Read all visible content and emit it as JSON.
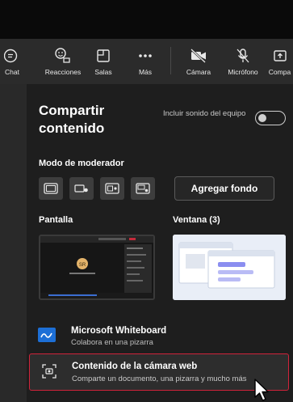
{
  "toolbar": {
    "chat": "Chat",
    "reactions": "Reacciones",
    "rooms": "Salas",
    "more": "Más",
    "camera": "Cámara",
    "mic": "Micrófono",
    "share": "Compa"
  },
  "panel": {
    "title": "Compartir contenido",
    "include_sound": "Incluir sonido del equipo",
    "sound_toggle": "off",
    "moderator_mode": "Modo de moderador",
    "add_background": "Agregar fondo",
    "screen_section": "Pantalla",
    "window_section": "Ventana (3)",
    "screen_thumb_initials": "SR",
    "whiteboard": {
      "title": "Microsoft Whiteboard",
      "subtitle": "Colabora en una pizarra"
    },
    "webcam_content": {
      "title": "Contenido de la cámara web",
      "subtitle": "Comparte un documento, una pizarra y mucho más"
    }
  },
  "colors": {
    "background": "#1e1e1e",
    "highlight_border": "#d0233a",
    "whiteboard_blue": "#1d6fd6"
  }
}
